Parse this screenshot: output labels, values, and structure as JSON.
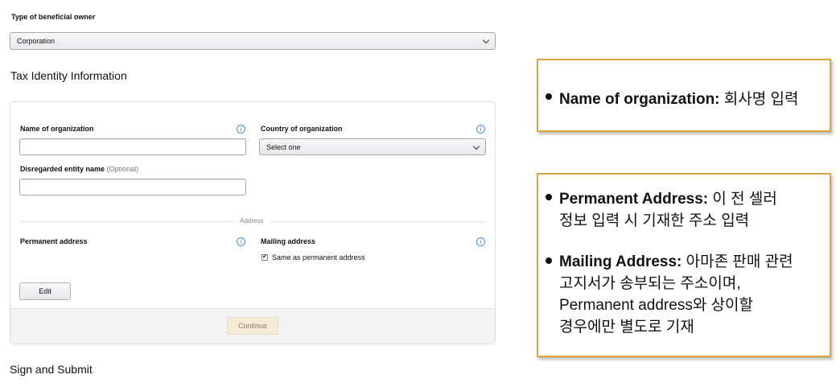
{
  "beneficial_owner": {
    "label": "Type of beneficial owner",
    "selected": "Corporation"
  },
  "tax_identity": {
    "title": "Tax Identity Information",
    "name_org_label": "Name of organization",
    "country_org_label": "Country of organization",
    "country_org_selected": "Select one",
    "disregarded_label": "Disregarded entity name",
    "disregarded_optional": "(Optional)",
    "address_divider": "Address",
    "permanent_address_label": "Permanent address",
    "mailing_address_label": "Mailing address",
    "same_as_permanent": "Same as permanent address",
    "edit_button": "Edit",
    "continue_button": "Continue",
    "info_glyph": "i"
  },
  "sign_submit": {
    "title": "Sign and Submit"
  },
  "callouts": {
    "first": {
      "term": "Name of organization:",
      "desc": " 회사명 입력"
    },
    "second": {
      "term1": "Permanent Address:",
      "desc1_line1": " 이 전 셀러",
      "desc1_line2": "정보 입력 시 기재한 주소 입력",
      "term2": "Mailing Address:",
      "desc2_line1": " 아마존 판매 관련",
      "desc2_line2": "고지서가 송부되는 주소이며,",
      "desc2_line3": "Permanent address와 상이할",
      "desc2_line4": "경우에만 별도로 기재"
    }
  },
  "colors": {
    "callout_border": "#e0a33b",
    "info_icon": "#4b8fd5",
    "continue_bg": "#f5ecd8"
  }
}
